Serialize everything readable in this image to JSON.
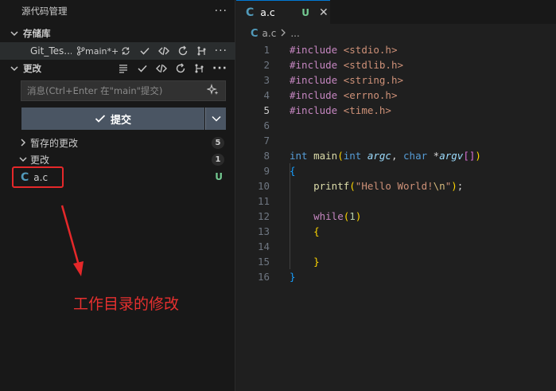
{
  "sidebar": {
    "title": "源代码管理",
    "repos_section": "存储库",
    "repo": {
      "name": "Git_Tes...",
      "branch": "main*+"
    },
    "changes_section": "更改",
    "message_placeholder": "消息(Ctrl+Enter 在\"main\"提交)",
    "commit_label": "提交",
    "staged": {
      "label": "暂存的更改",
      "count": "5"
    },
    "changes": {
      "label": "更改",
      "count": "1"
    },
    "file": {
      "name": "a.c",
      "status": "U",
      "icon": "c-file-icon"
    }
  },
  "annotation": {
    "text": "工作目录的修改",
    "color": "#e5282a"
  },
  "editor": {
    "tab": {
      "label": "a.c",
      "status": "U"
    },
    "breadcrumb": {
      "file": "a.c",
      "more": "..."
    },
    "active_line": 5,
    "lines": [
      {
        "n": "1"
      },
      {
        "n": "2"
      },
      {
        "n": "3"
      },
      {
        "n": "4"
      },
      {
        "n": "5"
      },
      {
        "n": "6"
      },
      {
        "n": "7"
      },
      {
        "n": "8"
      },
      {
        "n": "9"
      },
      {
        "n": "10"
      },
      {
        "n": "11"
      },
      {
        "n": "12"
      },
      {
        "n": "13"
      },
      {
        "n": "14"
      },
      {
        "n": "15"
      },
      {
        "n": "16"
      }
    ],
    "code": {
      "inc_kw": "#include",
      "inc1": "<stdio.h>",
      "inc2": "<stdlib.h>",
      "inc3": "<string.h>",
      "inc4": "<errno.h>",
      "inc5": "<time.h>",
      "int": "int",
      "main": "main",
      "char": "char",
      "argc": "argc",
      "argv": "argv",
      "printf": "printf",
      "hello": "\"Hello World!",
      "newline": "\\n",
      "quote": "\"",
      "while": "while",
      "one": "1"
    }
  },
  "colors": {
    "accent": "#0078d4",
    "untracked": "#73c991",
    "c_icon": "#519aba"
  }
}
